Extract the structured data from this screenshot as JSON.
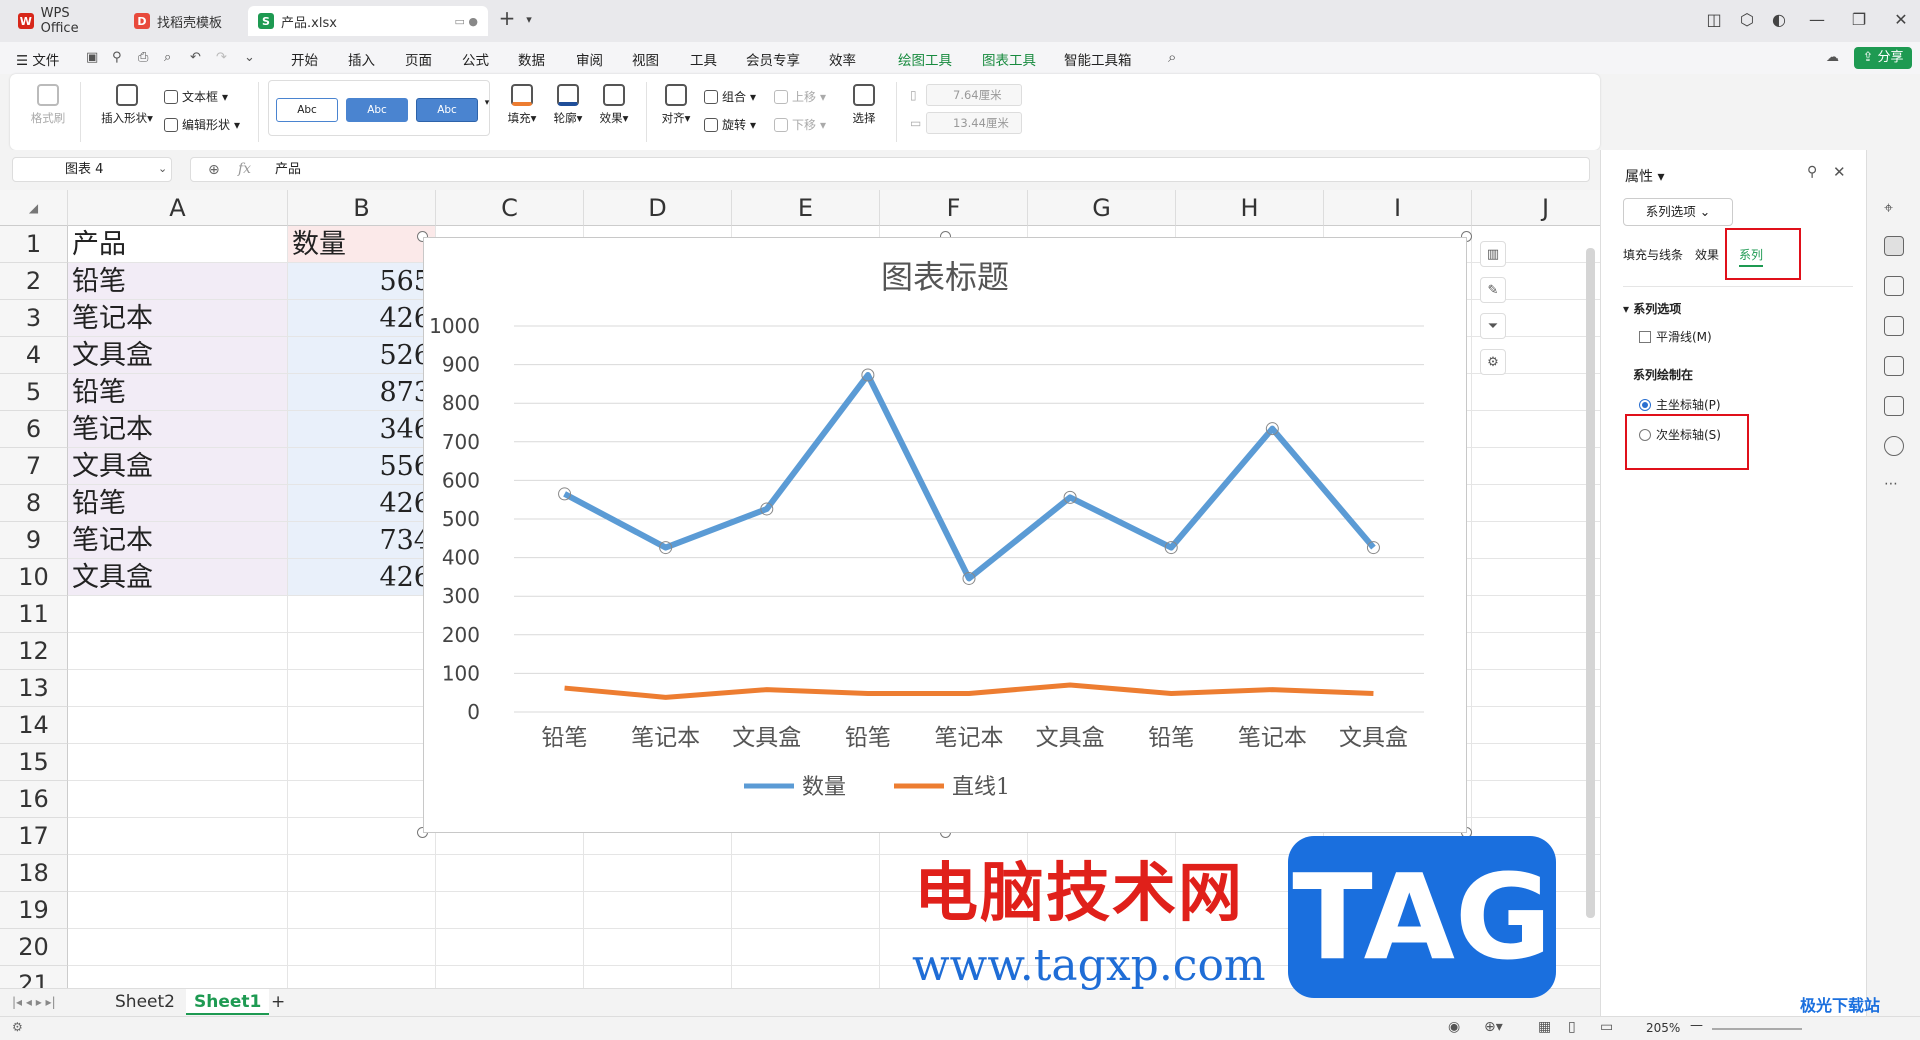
{
  "titlebar": {
    "tabs": [
      {
        "label": "WPS Office",
        "icon": "wps-logo-icon",
        "color": "#d7271a"
      },
      {
        "label": "找稻壳模板",
        "icon": "docer-icon",
        "color": "#e84a3c"
      },
      {
        "label": "产品.xlsx",
        "icon": "spreadsheet-icon",
        "color": "#1e9a52"
      }
    ],
    "new_tab": "+"
  },
  "menubar": {
    "file": "文件",
    "items": [
      "开始",
      "插入",
      "页面",
      "公式",
      "数据",
      "审阅",
      "视图",
      "工具",
      "会员专享",
      "效率",
      "绘图工具",
      "图表工具",
      "智能工具箱"
    ],
    "active": "绘图工具",
    "share": "分享"
  },
  "ribbon": {
    "format_painter": "格式刷",
    "insert_shape": "插入形状",
    "text_box": "文本框",
    "edit_shape": "编辑形状",
    "styles": [
      "Abc",
      "Abc",
      "Abc"
    ],
    "fill": "填充",
    "outline": "轮廓",
    "effect": "效果",
    "align": "对齐",
    "group": "组合",
    "rotate": "旋转",
    "move_up": "上移",
    "move_down": "下移",
    "select": "选择",
    "height": "7.64厘米",
    "width": "13.44厘米"
  },
  "formulabar": {
    "name_box": "图表 4",
    "fx": "fx",
    "content": "产品"
  },
  "sheet": {
    "columns": [
      "A",
      "B",
      "C",
      "D",
      "E",
      "F",
      "G",
      "H",
      "I",
      "J"
    ],
    "rows": [
      "1",
      "2",
      "3",
      "4",
      "5",
      "6",
      "7",
      "8",
      "9",
      "10",
      "11",
      "12",
      "13",
      "14",
      "15",
      "16",
      "17",
      "18",
      "19",
      "20",
      "21"
    ],
    "header": {
      "a": "产品",
      "b": "数量"
    },
    "data": [
      {
        "a": "铅笔",
        "b": "565"
      },
      {
        "a": "笔记本",
        "b": "426"
      },
      {
        "a": "文具盒",
        "b": "526"
      },
      {
        "a": "铅笔",
        "b": "873"
      },
      {
        "a": "笔记本",
        "b": "346"
      },
      {
        "a": "文具盒",
        "b": "556"
      },
      {
        "a": "铅笔",
        "b": "426"
      },
      {
        "a": "笔记本",
        "b": "734"
      },
      {
        "a": "文具盒",
        "b": "426"
      }
    ],
    "tabs": [
      "Sheet2",
      "Sheet1"
    ],
    "active_tab": "Sheet1"
  },
  "chart_data": {
    "type": "line",
    "title": "图表标题",
    "categories": [
      "铅笔",
      "笔记本",
      "文具盒",
      "铅笔",
      "笔记本",
      "文具盒",
      "铅笔",
      "笔记本",
      "文具盒"
    ],
    "series": [
      {
        "name": "数量",
        "values": [
          565,
          426,
          526,
          873,
          346,
          556,
          426,
          734,
          426
        ],
        "color": "#5b9bd5"
      },
      {
        "name": "直线1",
        "values": [
          62,
          38,
          58,
          48,
          48,
          70,
          48,
          58,
          48
        ],
        "color": "#ed7d31"
      }
    ],
    "yticks": [
      "0",
      "100",
      "200",
      "300",
      "400",
      "500",
      "600",
      "700",
      "800",
      "900",
      "1000"
    ],
    "ylim": [
      0,
      1000
    ],
    "grid": true,
    "legend": "bottom"
  },
  "panel": {
    "title": "属性",
    "options_dropdown": "系列选项",
    "tabs": [
      "填充与线条",
      "效果",
      "系列"
    ],
    "active_tab": "系列",
    "section": "系列选项",
    "smooth": "平滑线(M)",
    "plot_on": "系列绘制在",
    "primary_axis": "主坐标轴(P)",
    "secondary_axis": "次坐标轴(S)"
  },
  "statusbar": {
    "zoom": "205%"
  },
  "watermark": {
    "cn": "电脑技术网",
    "url": "www.tagxp.com",
    "tag": "TAG",
    "site": "极光下载站"
  }
}
